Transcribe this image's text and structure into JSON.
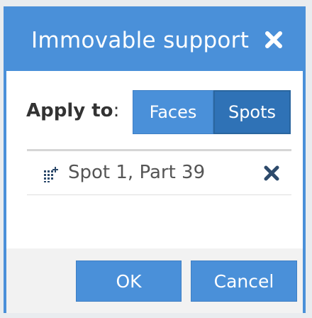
{
  "dialog": {
    "title": "Immovable support",
    "close_icon": "close-icon"
  },
  "apply": {
    "label_bold": "Apply to",
    "label_suffix": ":",
    "options": [
      "Faces",
      "Spots"
    ],
    "selected": "Spots"
  },
  "spots": [
    {
      "icon": "spot-points-icon",
      "label": "Spot 1, Part 39",
      "remove_icon": "remove-icon"
    }
  ],
  "footer": {
    "ok_label": "OK",
    "cancel_label": "Cancel"
  },
  "colors": {
    "accent": "#4a90d9",
    "accent_selected": "#2f72b6",
    "dark_icon": "#2d4a6b"
  }
}
